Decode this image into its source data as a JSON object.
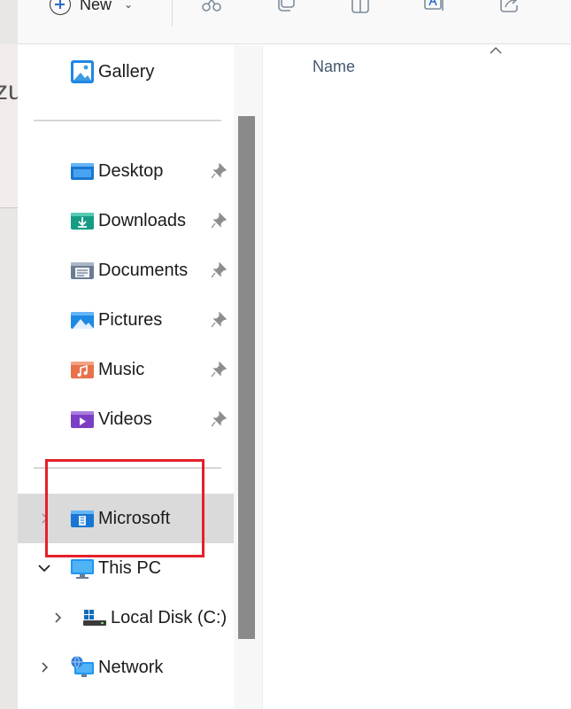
{
  "toolbar": {
    "new_label": "New"
  },
  "background": {
    "peek_text": "zu"
  },
  "navigation": {
    "gallery": "Gallery",
    "quick_access": [
      {
        "label": "Desktop",
        "icon": "desktop-folder-icon",
        "pinned": true
      },
      {
        "label": "Downloads",
        "icon": "downloads-folder-icon",
        "pinned": true
      },
      {
        "label": "Documents",
        "icon": "documents-folder-icon",
        "pinned": true
      },
      {
        "label": "Pictures",
        "icon": "pictures-folder-icon",
        "pinned": true
      },
      {
        "label": "Music",
        "icon": "music-folder-icon",
        "pinned": true
      },
      {
        "label": "Videos",
        "icon": "videos-folder-icon",
        "pinned": true
      }
    ],
    "microsoft": "Microsoft",
    "this_pc": "This PC",
    "local_disk": "Local Disk (C:)",
    "network": "Network"
  },
  "content": {
    "column_name": "Name"
  },
  "colors": {
    "highlight": "#e5202b",
    "selected_bg": "#dadada",
    "scroll_thumb": "#8a8a8a"
  }
}
